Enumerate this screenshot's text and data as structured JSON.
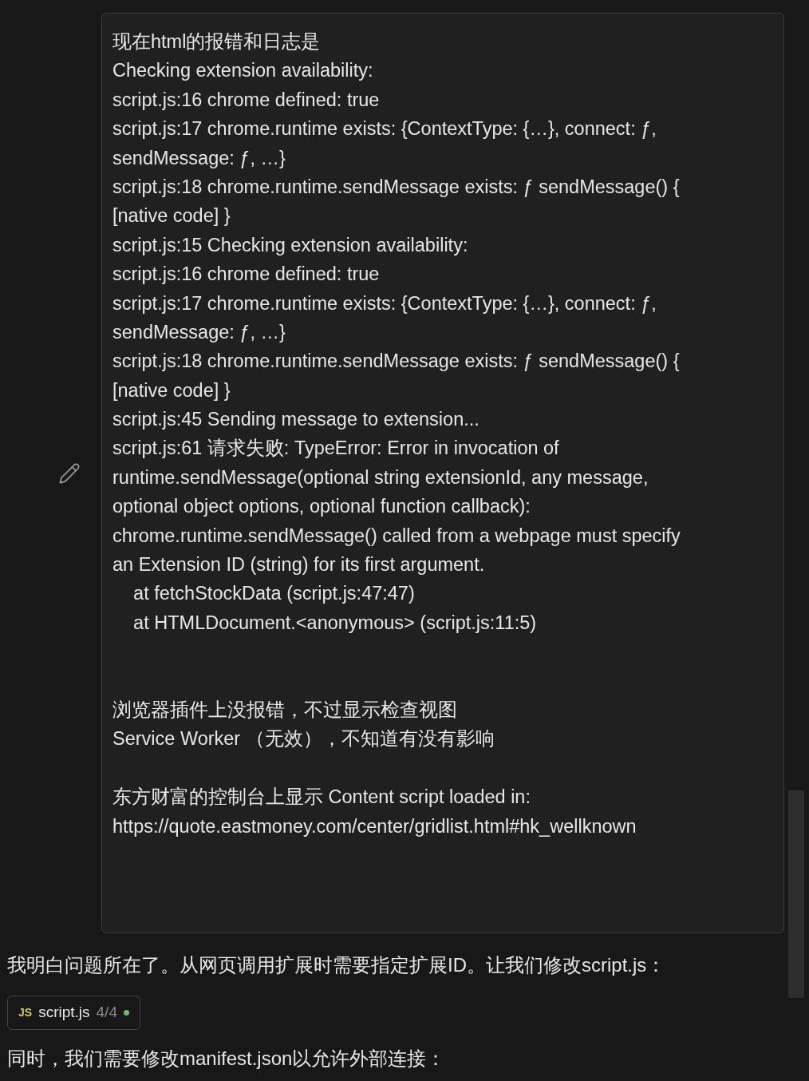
{
  "user_message": {
    "lines": [
      {
        "kind": "line",
        "text": "现在html的报错和日志是"
      },
      {
        "kind": "line",
        "text": "Checking extension availability:"
      },
      {
        "kind": "line",
        "text": "script.js:16 chrome defined: true"
      },
      {
        "kind": "line",
        "text": "script.js:17 chrome.runtime exists: {ContextType: {…}, connect: ƒ,"
      },
      {
        "kind": "line",
        "text": "sendMessage: ƒ, …}"
      },
      {
        "kind": "line",
        "text": "script.js:18 chrome.runtime.sendMessage exists: ƒ sendMessage() {"
      },
      {
        "kind": "line",
        "text": "[native code] }"
      },
      {
        "kind": "line",
        "text": "script.js:15 Checking extension availability:"
      },
      {
        "kind": "line",
        "text": "script.js:16 chrome defined: true"
      },
      {
        "kind": "line",
        "text": "script.js:17 chrome.runtime exists: {ContextType: {…}, connect: ƒ,"
      },
      {
        "kind": "line",
        "text": "sendMessage: ƒ, …}"
      },
      {
        "kind": "line",
        "text": "script.js:18 chrome.runtime.sendMessage exists: ƒ sendMessage() {"
      },
      {
        "kind": "line",
        "text": "[native code] }"
      },
      {
        "kind": "line",
        "text": "script.js:45 Sending message to extension..."
      },
      {
        "kind": "line",
        "text": "script.js:61 请求失败: TypeError: Error in invocation of"
      },
      {
        "kind": "line",
        "text": "runtime.sendMessage(optional string extensionId, any message,"
      },
      {
        "kind": "line",
        "text": "optional object options, optional function callback):"
      },
      {
        "kind": "line",
        "text": "chrome.runtime.sendMessage() called from a webpage must specify"
      },
      {
        "kind": "line",
        "text": "an Extension ID (string) for its first argument."
      },
      {
        "kind": "line",
        "text": "    at fetchStockData (script.js:47:47)"
      },
      {
        "kind": "line",
        "text": "    at HTMLDocument.<anonymous> (script.js:11:5)"
      },
      {
        "kind": "blank"
      },
      {
        "kind": "blank"
      },
      {
        "kind": "line",
        "text": "浏览器插件上没报错，不过显示检查视图"
      },
      {
        "kind": "line",
        "text": "Service Worker （无效），不知道有没有影响"
      },
      {
        "kind": "blank"
      },
      {
        "kind": "line",
        "text": "东方财富的控制台上显示 Content script loaded in:"
      },
      {
        "kind": "line",
        "text": "https://quote.eastmoney.com/center/gridlist.html#hk_wellknown"
      }
    ]
  },
  "reply_text": "我明白问题所在了。从网页调用扩展时需要指定扩展ID。让我们修改script.js：",
  "file_chip": {
    "badge": "JS",
    "name": "script.js",
    "count": "4/4",
    "color": "#6cc070"
  },
  "followup_text": "同时，我们需要修改manifest.json以允许外部连接："
}
